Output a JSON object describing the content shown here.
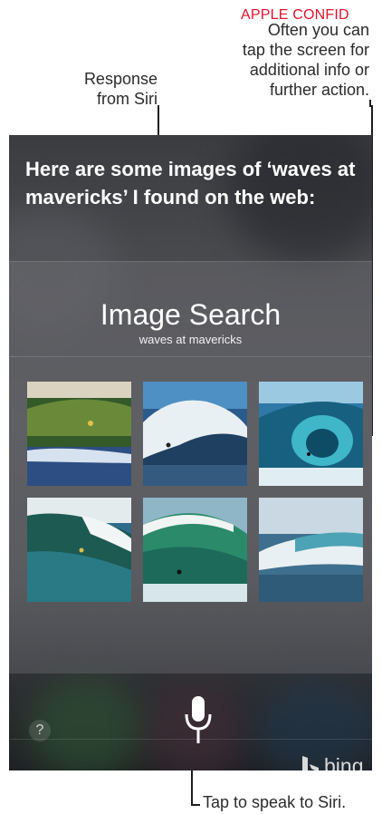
{
  "watermark": "APPLE CONFID",
  "callouts": {
    "response_line1": "Response",
    "response_line2": "from Siri",
    "tip_line1": "Often you can",
    "tip_line2": "tap the screen for",
    "tip_line3": "additional info or",
    "tip_line4": "further action.",
    "tap": "Tap to speak to Siri."
  },
  "siri": {
    "response_text": "Here are some images of ‘waves at mavericks’ I found on the web:",
    "card_title": "Image Search",
    "card_subtitle": "waves at mavericks",
    "thumbnails": [
      "surfer-on-wave-image-1",
      "big-wave-surfer-image-2",
      "wave-barrel-image-3",
      "surfer-under-lip-image-4",
      "surfer-dropping-in-image-5",
      "wave-breaking-image-6"
    ],
    "provider": "bing",
    "help_symbol": "?"
  },
  "colors": {
    "watermark": "#e5122b",
    "panel": "#4a4b4f"
  }
}
